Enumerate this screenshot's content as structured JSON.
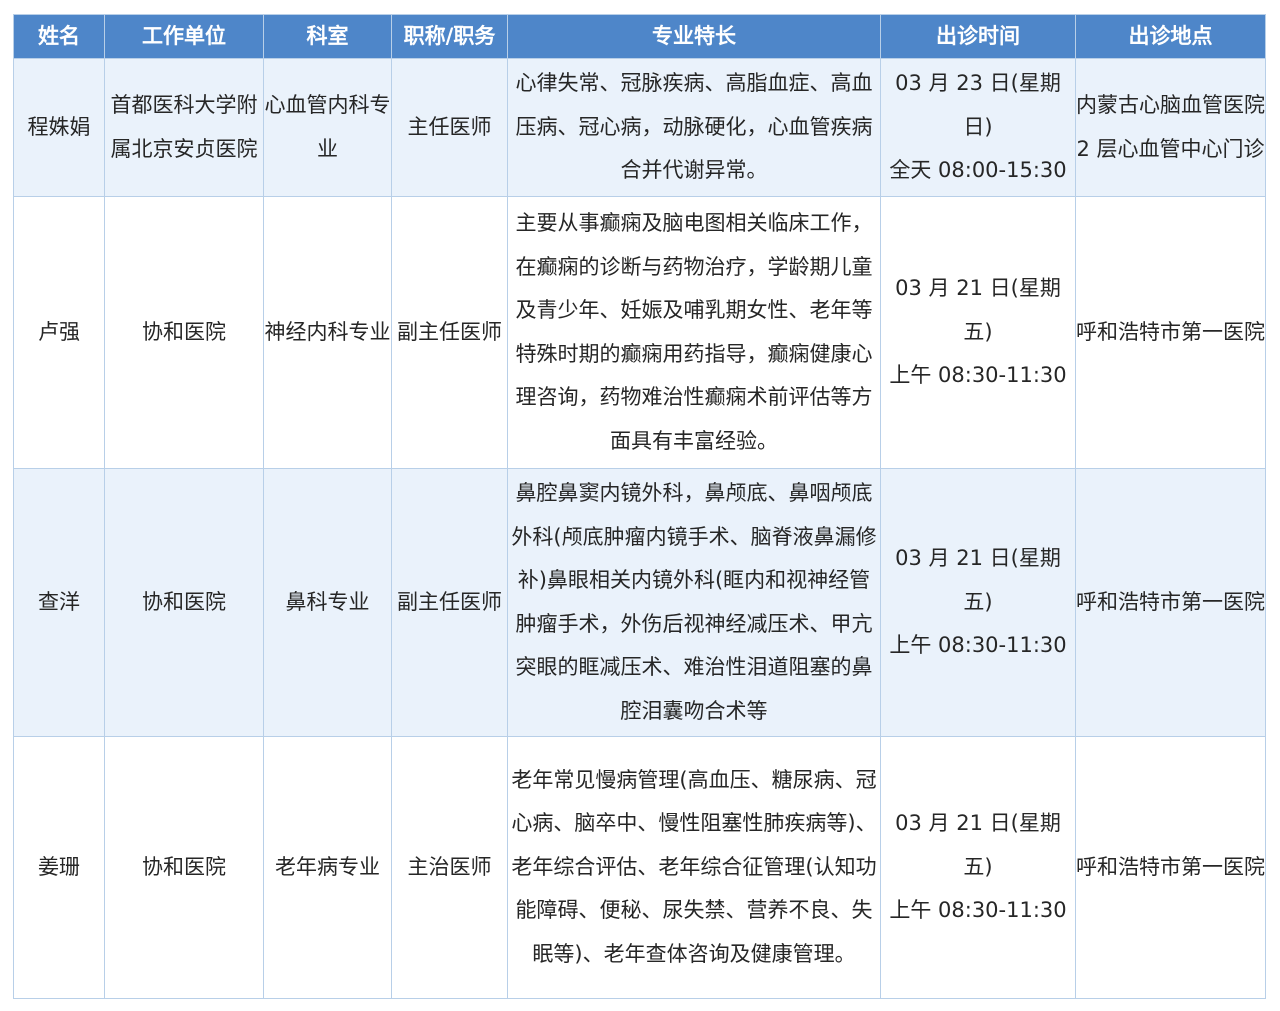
{
  "headers": [
    "姓名",
    "工作单位",
    "科室",
    "职称/职务",
    "专业特长",
    "出诊时间",
    "出诊地点"
  ],
  "rows": [
    {
      "name": "程姝娟",
      "unit": "首都医科大学附属北京安贞医院",
      "dept": "心血管内科专业",
      "title": "主任医师",
      "specialty": "心律失常、冠脉疾病、高脂血症、高血压病、冠心病，动脉硬化，心血管疾病合并代谢异常。",
      "time_date": "03 月 23 日(星期日)",
      "time_slot": "全天 08:00-15:30",
      "location": "内蒙古心脑血管医院 2 层心血管中心门诊"
    },
    {
      "name": "卢强",
      "unit": "协和医院",
      "dept": "神经内科专业",
      "title": "副主任医师",
      "specialty": "主要从事癫痫及脑电图相关临床工作，在癫痫的诊断与药物治疗，学龄期儿童及青少年、妊娠及哺乳期女性、老年等特殊时期的癫痫用药指导，癫痫健康心理咨询，药物难治性癫痫术前评估等方面具有丰富经验。",
      "time_date": "03 月 21 日(星期五)",
      "time_slot": "上午 08:30-11:30",
      "location": "呼和浩特市第一医院"
    },
    {
      "name": "查洋",
      "unit": "协和医院",
      "dept": "鼻科专业",
      "title": "副主任医师",
      "specialty": "鼻腔鼻窦内镜外科，鼻颅底、鼻咽颅底外科(颅底肿瘤内镜手术、脑脊液鼻漏修补)鼻眼相关内镜外科(眶内和视神经管肿瘤手术，外伤后视神经减压术、甲亢突眼的眶减压术、难治性泪道阻塞的鼻腔泪囊吻合术等",
      "time_date": "03 月 21 日(星期五)",
      "time_slot": "上午 08:30-11:30",
      "location": "呼和浩特市第一医院"
    },
    {
      "name": "姜珊",
      "unit": "协和医院",
      "dept": "老年病专业",
      "title": "主治医师",
      "specialty": "老年常见慢病管理(高血压、糖尿病、冠心病、脑卒中、慢性阻塞性肺疾病等)、老年综合评估、老年综合征管理(认知功能障碍、便秘、尿失禁、营养不良、失眠等)、老年查体咨询及健康管理。",
      "time_date": "03 月 21 日(星期五)",
      "time_slot": "上午 08:30-11:30",
      "location": "呼和浩特市第一医院"
    }
  ]
}
